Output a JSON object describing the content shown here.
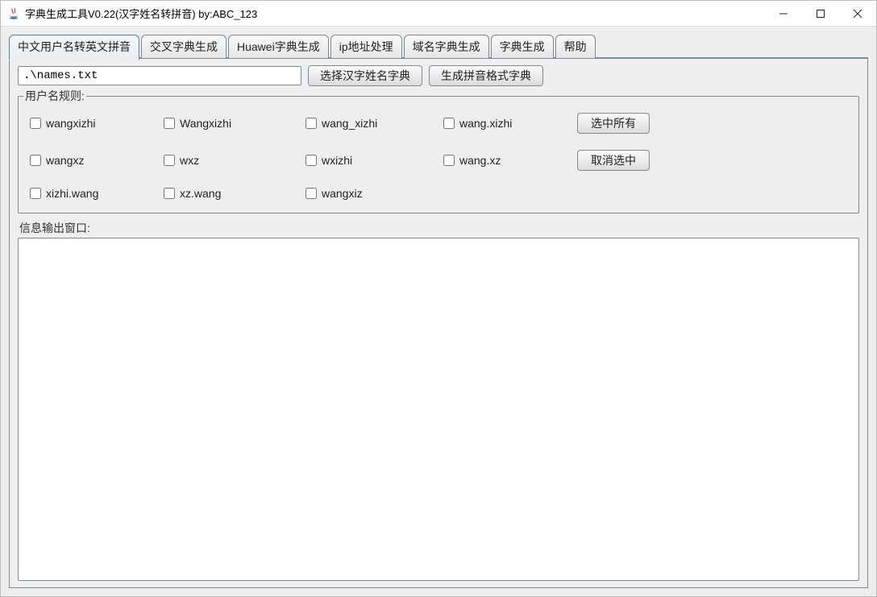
{
  "window": {
    "title": "字典生成工具V0.22(汉字姓名转拼音) by:ABC_123"
  },
  "tabs": [
    {
      "label": "中文用户名转英文拼音"
    },
    {
      "label": "交叉字典生成"
    },
    {
      "label": "Huawei字典生成"
    },
    {
      "label": "ip地址处理"
    },
    {
      "label": "域名字典生成"
    },
    {
      "label": "字典生成"
    },
    {
      "label": "帮助"
    }
  ],
  "path_input_value": ".\\names.txt",
  "buttons": {
    "choose_dict": "选择汉字姓名字典",
    "generate_pinyin": "生成拼音格式字典",
    "select_all": "选中所有",
    "deselect_all": "取消选中"
  },
  "groups": {
    "rules_label": "用户名规则:",
    "output_label": "信息输出窗口:"
  },
  "rules": [
    {
      "label": "wangxizhi"
    },
    {
      "label": "Wangxizhi"
    },
    {
      "label": "wang_xizhi"
    },
    {
      "label": "wang.xizhi"
    },
    {
      "label": "wangxz"
    },
    {
      "label": "wxz"
    },
    {
      "label": "wxizhi"
    },
    {
      "label": "wang.xz"
    },
    {
      "label": "xizhi.wang"
    },
    {
      "label": "xz.wang"
    },
    {
      "label": "wangxiz"
    }
  ]
}
